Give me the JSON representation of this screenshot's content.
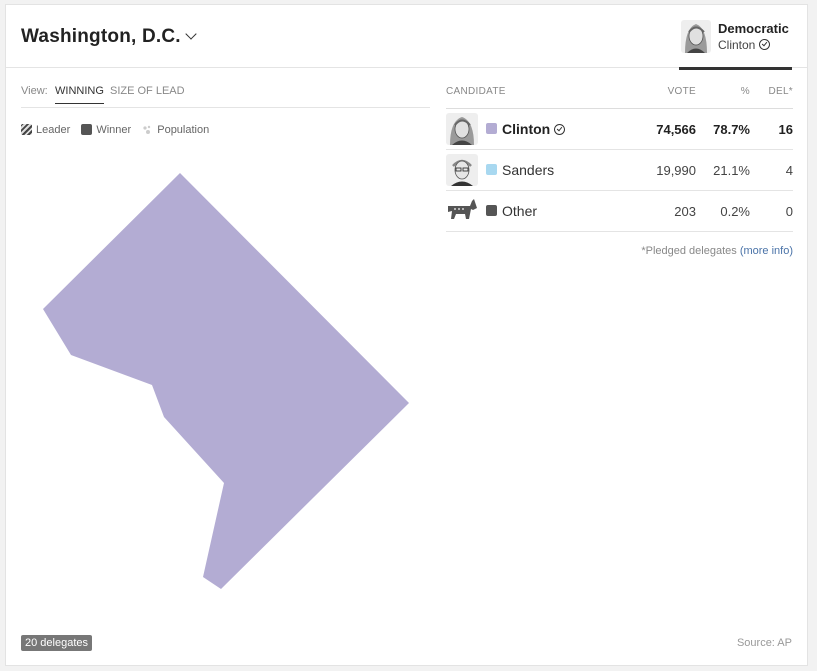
{
  "header": {
    "state": "Washington, D.C.",
    "party": "Democratic",
    "party_winner": "Clinton"
  },
  "view": {
    "label": "View:",
    "tabs": [
      "WINNING",
      "SIZE OF LEAD"
    ],
    "active": "WINNING"
  },
  "legend": {
    "leader": "Leader",
    "winner": "Winner",
    "population": "Population"
  },
  "map": {
    "region": "Washington, D.C.",
    "fill_color": "#b3acd3"
  },
  "table": {
    "headers": {
      "candidate": "CANDIDATE",
      "vote": "VOTE",
      "pct": "%",
      "del": "DEL*"
    },
    "rows": [
      {
        "name": "Clinton",
        "vote": "74,566",
        "pct": "78.7%",
        "del": "16",
        "color": "#b3acd3",
        "winner": true,
        "icon": "clinton-portrait-icon"
      },
      {
        "name": "Sanders",
        "vote": "19,990",
        "pct": "21.1%",
        "del": "4",
        "color": "#a8d8f0",
        "winner": false,
        "icon": "sanders-portrait-icon"
      },
      {
        "name": "Other",
        "vote": "203",
        "pct": "0.2%",
        "del": "0",
        "color": "#555555",
        "winner": false,
        "icon": "democrat-donkey-icon"
      }
    ],
    "footnote_text": "*Pledged delegates",
    "footnote_link": "(more info)"
  },
  "footer": {
    "delegates": "20 delegates",
    "source": "Source: AP"
  }
}
